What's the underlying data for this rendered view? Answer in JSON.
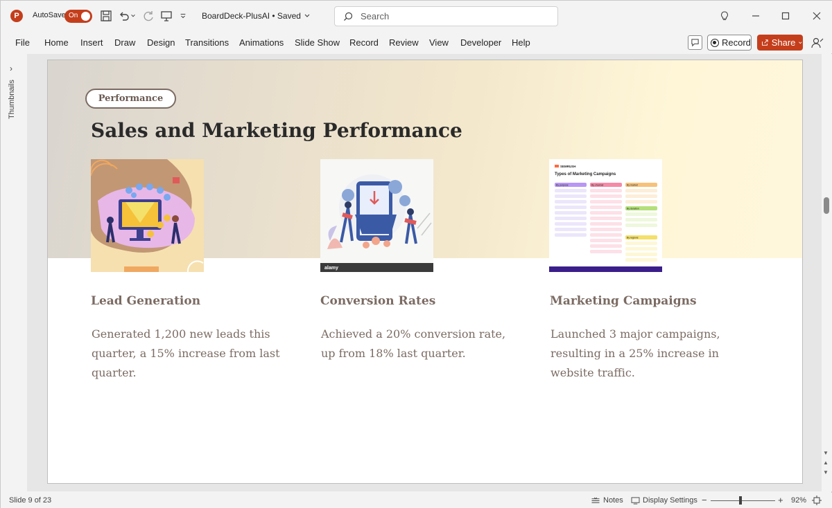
{
  "titlebar": {
    "autosave_label": "AutoSave",
    "autosave_state": "On",
    "doc_title": "BoardDeck-PlusAI • Saved",
    "search_placeholder": "Search",
    "accent_color": "#c43e1c"
  },
  "ribbon": {
    "tabs": [
      "File",
      "Home",
      "Insert",
      "Draw",
      "Design",
      "Transitions",
      "Animations",
      "Slide Show",
      "Record",
      "Review",
      "View",
      "Developer",
      "Help"
    ],
    "record_label": "Record",
    "share_label": "Share"
  },
  "thumbnails": {
    "label": "Thumbnails"
  },
  "slide": {
    "tag": "Performance",
    "title": "Sales and Marketing Performance",
    "cards": [
      {
        "heading": "Lead Generation",
        "body": "Generated 1,200 new leads this quarter, a 15% increase from last quarter."
      },
      {
        "heading": "Conversion Rates",
        "body": "Achieved a 20% conversion rate, up from 18% last quarter."
      },
      {
        "heading": "Marketing Campaigns",
        "body": "Launched 3 major campaigns, resulting in a 25% increase in website traffic."
      }
    ],
    "campaign_image": {
      "brand": "SEMRUSH",
      "title": "Types of Marketing Campaigns",
      "col1_header": "By purpose",
      "col2_header": "By channel",
      "col3_header": "By market",
      "col3b_header": "By duration",
      "col3c_header": "By regions"
    },
    "conversion_image": {
      "footer_brand": "alamy"
    }
  },
  "statusbar": {
    "slide_info": "Slide 9 of 23",
    "notes_label": "Notes",
    "display_label": "Display Settings",
    "zoom_minus": "−",
    "zoom_plus": "+",
    "zoom": "92%"
  }
}
